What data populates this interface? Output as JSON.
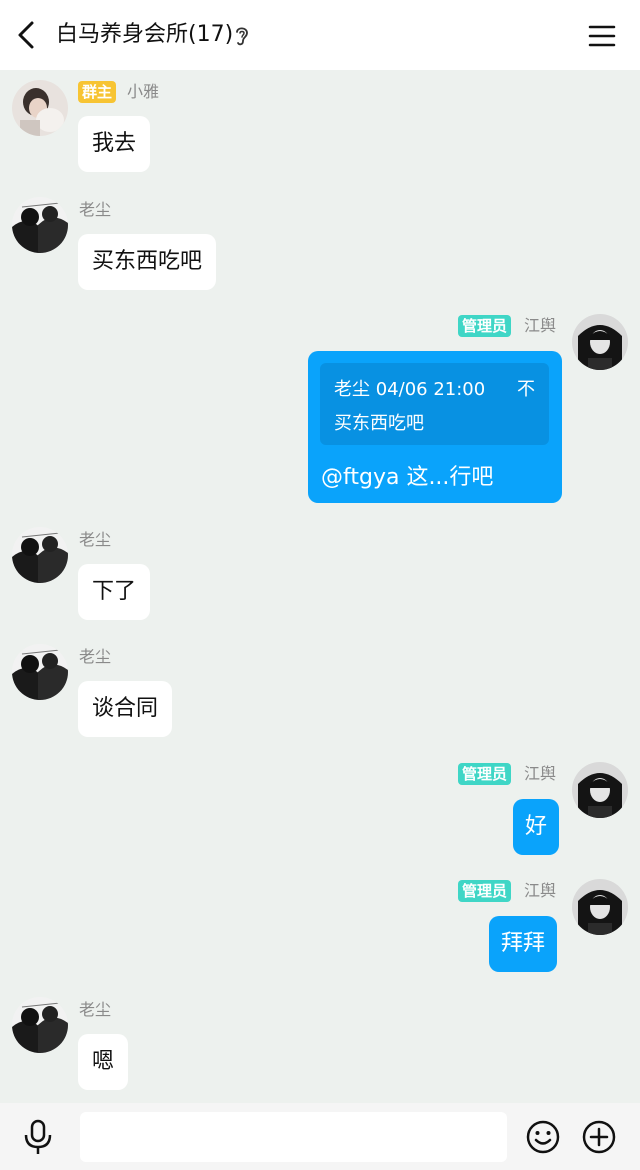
{
  "header": {
    "title": "白马养身会所(17)",
    "back_icon": "chevron-left-icon",
    "ear_icon": "ear-icon",
    "menu_icon": "hamburger-menu-icon"
  },
  "messages": [
    {
      "sender": "小雅",
      "badge": "群主",
      "text": "我去",
      "side": "left"
    },
    {
      "sender": "老尘",
      "text": "买东西吃吧",
      "side": "left"
    },
    {
      "sender": "江舆",
      "badge": "管理员",
      "side": "right",
      "quote": {
        "header": "老尘 04/06 21:00",
        "close": "不",
        "text": "买东西吃吧"
      },
      "text": "@ftgya 这...行吧"
    },
    {
      "sender": "老尘",
      "text": "下了",
      "side": "left"
    },
    {
      "sender": "老尘",
      "text": "谈合同",
      "side": "left"
    },
    {
      "sender": "江舆",
      "badge": "管理员",
      "text": "好",
      "side": "right"
    },
    {
      "sender": "江舆",
      "badge": "管理员",
      "text": "拜拜",
      "side": "right"
    },
    {
      "sender": "老尘",
      "text": "嗯",
      "side": "left"
    }
  ],
  "footer": {
    "input_value": "",
    "mic_icon": "microphone-icon",
    "emoji_icon": "emoji-icon",
    "plus_icon": "plus-circle-icon"
  },
  "colors": {
    "chat_background": "#edf1ee",
    "outgoing_bubble": "#0aa3fb",
    "owner_badge": "#f7c433",
    "admin_badge": "#3fd6c6"
  }
}
